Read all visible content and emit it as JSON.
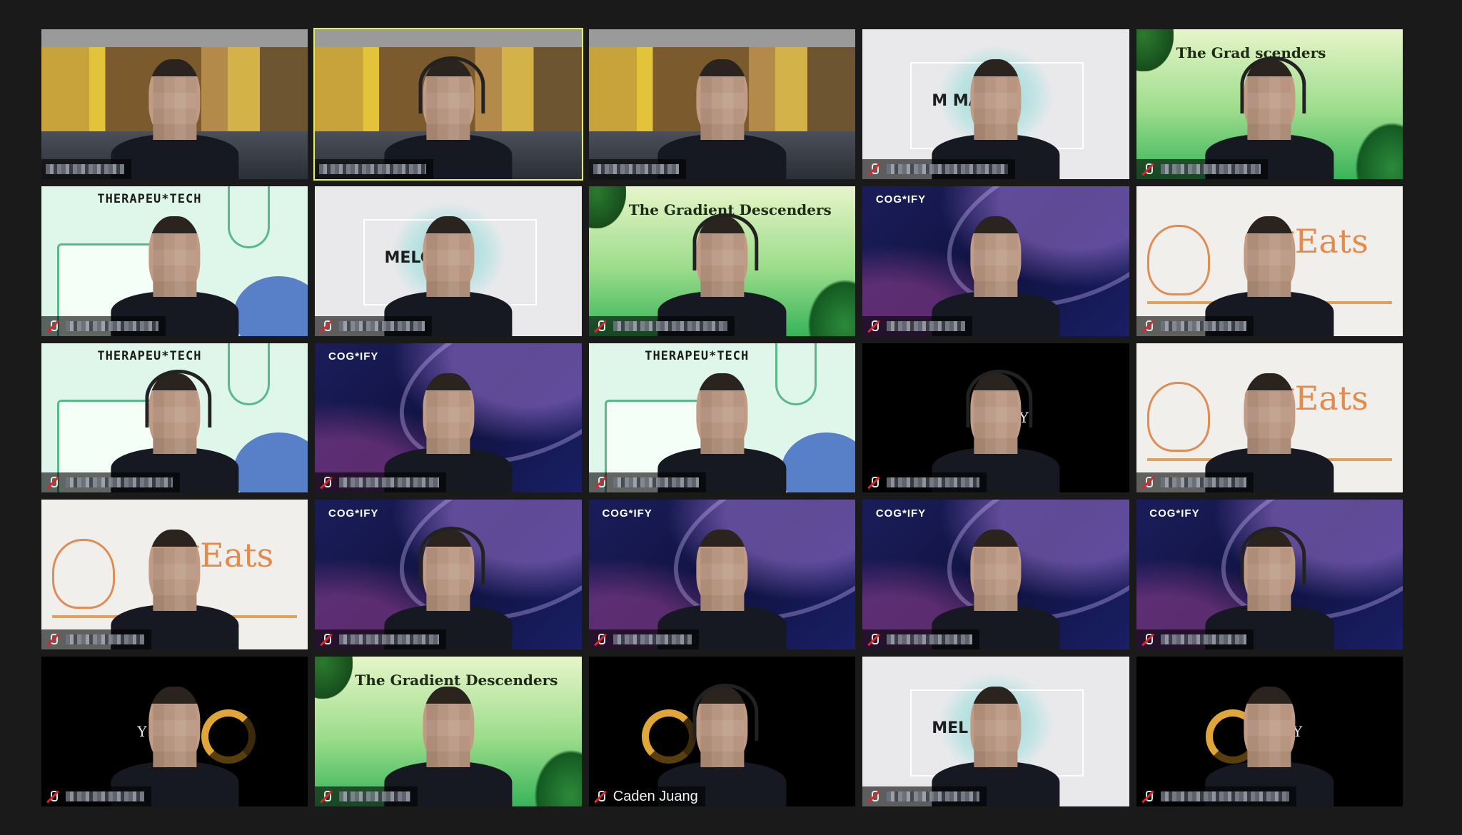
{
  "app": "Zoom",
  "view": "gallery",
  "active_speaker_color": "#e6f051",
  "muted_icon_color": "#e0242b",
  "tiles": [
    {
      "bg": "office",
      "label": "",
      "brand": "",
      "muted": false,
      "active": false
    },
    {
      "bg": "office",
      "label": "",
      "brand": "",
      "muted": false,
      "active": true
    },
    {
      "bg": "office",
      "label": "",
      "brand": "",
      "muted": false,
      "active": false
    },
    {
      "bg": "white",
      "label": "",
      "brand": "M          MATE",
      "muted": true,
      "active": false
    },
    {
      "bg": "green",
      "label": "",
      "brand": "The Grad       scenders",
      "muted": true,
      "active": false
    },
    {
      "bg": "therapeu",
      "label": "",
      "brand": "THERAPEU*TECH",
      "muted": true,
      "active": false
    },
    {
      "bg": "white",
      "label": "",
      "brand": "MELODY",
      "muted": true,
      "active": false
    },
    {
      "bg": "green",
      "label": "",
      "brand": "The Gradient Descenders",
      "muted": true,
      "active": false
    },
    {
      "bg": "cog",
      "label": "",
      "brand": "COG*IFY",
      "muted": true,
      "active": false
    },
    {
      "bg": "eats",
      "label": "",
      "brand": "C      *Eats",
      "muted": true,
      "active": false
    },
    {
      "bg": "therapeu",
      "label": "",
      "brand": "THERAPEU*TECH",
      "muted": true,
      "active": false
    },
    {
      "bg": "cog",
      "label": "",
      "brand": "COG*IFY",
      "muted": true,
      "active": false
    },
    {
      "bg": "therapeu",
      "label": "",
      "brand": "THERAPEU*TECH",
      "muted": true,
      "active": false
    },
    {
      "bg": "black",
      "label": "",
      "brand": "3B1Y",
      "muted": true,
      "active": false
    },
    {
      "bg": "eats",
      "label": "",
      "brand": "C      *Eats",
      "muted": true,
      "active": false
    },
    {
      "bg": "eats",
      "label": "",
      "brand": "C      *Eats",
      "muted": true,
      "active": false
    },
    {
      "bg": "cog",
      "label": "",
      "brand": "COG*IFY",
      "muted": true,
      "active": false
    },
    {
      "bg": "cog",
      "label": "",
      "brand": "COG*IFY",
      "muted": true,
      "active": false
    },
    {
      "bg": "cog",
      "label": "",
      "brand": "COG*IFY",
      "muted": true,
      "active": false
    },
    {
      "bg": "cog",
      "label": "",
      "brand": "COG*IFY",
      "muted": true,
      "active": false
    },
    {
      "bg": "black",
      "label": "",
      "brand": "Y",
      "muted": true,
      "active": false
    },
    {
      "bg": "green",
      "label": "",
      "brand": "The Gradient Descenders",
      "muted": true,
      "active": false
    },
    {
      "bg": "black",
      "label": "Caden Juang",
      "brand": "",
      "muted": true,
      "active": false
    },
    {
      "bg": "white",
      "label": "",
      "brand": "MEL        TE",
      "muted": true,
      "active": false
    },
    {
      "bg": "black",
      "label": "",
      "brand": "3B1Y",
      "muted": true,
      "active": false
    }
  ]
}
